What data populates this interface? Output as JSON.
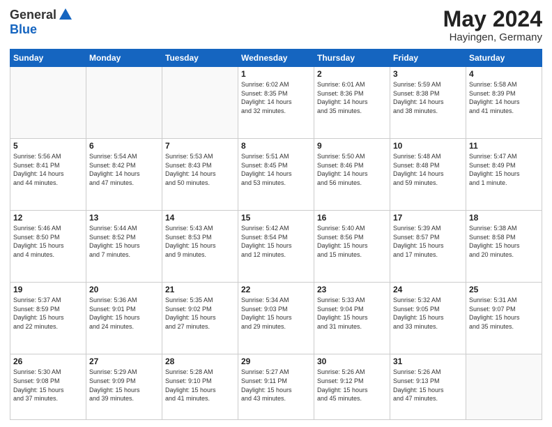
{
  "header": {
    "logo_general": "General",
    "logo_blue": "Blue",
    "month_year": "May 2024",
    "location": "Hayingen, Germany"
  },
  "days_of_week": [
    "Sunday",
    "Monday",
    "Tuesday",
    "Wednesday",
    "Thursday",
    "Friday",
    "Saturday"
  ],
  "weeks": [
    [
      {
        "day": "",
        "info": ""
      },
      {
        "day": "",
        "info": ""
      },
      {
        "day": "",
        "info": ""
      },
      {
        "day": "1",
        "info": "Sunrise: 6:02 AM\nSunset: 8:35 PM\nDaylight: 14 hours\nand 32 minutes."
      },
      {
        "day": "2",
        "info": "Sunrise: 6:01 AM\nSunset: 8:36 PM\nDaylight: 14 hours\nand 35 minutes."
      },
      {
        "day": "3",
        "info": "Sunrise: 5:59 AM\nSunset: 8:38 PM\nDaylight: 14 hours\nand 38 minutes."
      },
      {
        "day": "4",
        "info": "Sunrise: 5:58 AM\nSunset: 8:39 PM\nDaylight: 14 hours\nand 41 minutes."
      }
    ],
    [
      {
        "day": "5",
        "info": "Sunrise: 5:56 AM\nSunset: 8:41 PM\nDaylight: 14 hours\nand 44 minutes."
      },
      {
        "day": "6",
        "info": "Sunrise: 5:54 AM\nSunset: 8:42 PM\nDaylight: 14 hours\nand 47 minutes."
      },
      {
        "day": "7",
        "info": "Sunrise: 5:53 AM\nSunset: 8:43 PM\nDaylight: 14 hours\nand 50 minutes."
      },
      {
        "day": "8",
        "info": "Sunrise: 5:51 AM\nSunset: 8:45 PM\nDaylight: 14 hours\nand 53 minutes."
      },
      {
        "day": "9",
        "info": "Sunrise: 5:50 AM\nSunset: 8:46 PM\nDaylight: 14 hours\nand 56 minutes."
      },
      {
        "day": "10",
        "info": "Sunrise: 5:48 AM\nSunset: 8:48 PM\nDaylight: 14 hours\nand 59 minutes."
      },
      {
        "day": "11",
        "info": "Sunrise: 5:47 AM\nSunset: 8:49 PM\nDaylight: 15 hours\nand 1 minute."
      }
    ],
    [
      {
        "day": "12",
        "info": "Sunrise: 5:46 AM\nSunset: 8:50 PM\nDaylight: 15 hours\nand 4 minutes."
      },
      {
        "day": "13",
        "info": "Sunrise: 5:44 AM\nSunset: 8:52 PM\nDaylight: 15 hours\nand 7 minutes."
      },
      {
        "day": "14",
        "info": "Sunrise: 5:43 AM\nSunset: 8:53 PM\nDaylight: 15 hours\nand 9 minutes."
      },
      {
        "day": "15",
        "info": "Sunrise: 5:42 AM\nSunset: 8:54 PM\nDaylight: 15 hours\nand 12 minutes."
      },
      {
        "day": "16",
        "info": "Sunrise: 5:40 AM\nSunset: 8:56 PM\nDaylight: 15 hours\nand 15 minutes."
      },
      {
        "day": "17",
        "info": "Sunrise: 5:39 AM\nSunset: 8:57 PM\nDaylight: 15 hours\nand 17 minutes."
      },
      {
        "day": "18",
        "info": "Sunrise: 5:38 AM\nSunset: 8:58 PM\nDaylight: 15 hours\nand 20 minutes."
      }
    ],
    [
      {
        "day": "19",
        "info": "Sunrise: 5:37 AM\nSunset: 8:59 PM\nDaylight: 15 hours\nand 22 minutes."
      },
      {
        "day": "20",
        "info": "Sunrise: 5:36 AM\nSunset: 9:01 PM\nDaylight: 15 hours\nand 24 minutes."
      },
      {
        "day": "21",
        "info": "Sunrise: 5:35 AM\nSunset: 9:02 PM\nDaylight: 15 hours\nand 27 minutes."
      },
      {
        "day": "22",
        "info": "Sunrise: 5:34 AM\nSunset: 9:03 PM\nDaylight: 15 hours\nand 29 minutes."
      },
      {
        "day": "23",
        "info": "Sunrise: 5:33 AM\nSunset: 9:04 PM\nDaylight: 15 hours\nand 31 minutes."
      },
      {
        "day": "24",
        "info": "Sunrise: 5:32 AM\nSunset: 9:05 PM\nDaylight: 15 hours\nand 33 minutes."
      },
      {
        "day": "25",
        "info": "Sunrise: 5:31 AM\nSunset: 9:07 PM\nDaylight: 15 hours\nand 35 minutes."
      }
    ],
    [
      {
        "day": "26",
        "info": "Sunrise: 5:30 AM\nSunset: 9:08 PM\nDaylight: 15 hours\nand 37 minutes."
      },
      {
        "day": "27",
        "info": "Sunrise: 5:29 AM\nSunset: 9:09 PM\nDaylight: 15 hours\nand 39 minutes."
      },
      {
        "day": "28",
        "info": "Sunrise: 5:28 AM\nSunset: 9:10 PM\nDaylight: 15 hours\nand 41 minutes."
      },
      {
        "day": "29",
        "info": "Sunrise: 5:27 AM\nSunset: 9:11 PM\nDaylight: 15 hours\nand 43 minutes."
      },
      {
        "day": "30",
        "info": "Sunrise: 5:26 AM\nSunset: 9:12 PM\nDaylight: 15 hours\nand 45 minutes."
      },
      {
        "day": "31",
        "info": "Sunrise: 5:26 AM\nSunset: 9:13 PM\nDaylight: 15 hours\nand 47 minutes."
      },
      {
        "day": "",
        "info": ""
      }
    ]
  ]
}
